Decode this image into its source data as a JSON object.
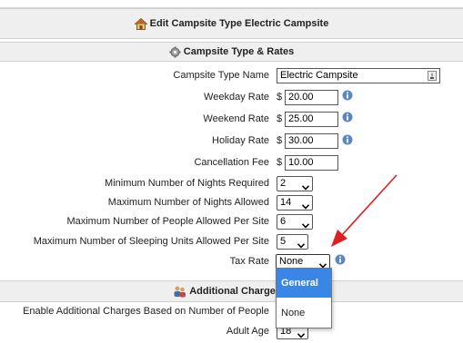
{
  "window": {
    "title": "Edit Campsite Type Electric Campsite"
  },
  "sections": {
    "type_rates": "Campsite Type & Rates",
    "additional_charges": "Additional Charges F"
  },
  "fields": {
    "type_name": {
      "label": "Campsite Type Name",
      "value": "Electric Campsite"
    },
    "weekday_rate": {
      "label": "Weekday Rate",
      "currency": "$",
      "value": "20.00"
    },
    "weekend_rate": {
      "label": "Weekend Rate",
      "currency": "$",
      "value": "25.00"
    },
    "holiday_rate": {
      "label": "Holiday Rate",
      "currency": "$",
      "value": "30.00"
    },
    "cancellation_fee": {
      "label": "Cancellation Fee",
      "currency": "$",
      "value": "10.00"
    },
    "min_nights": {
      "label": "Minimum Number of Nights Required",
      "value": "2"
    },
    "max_nights": {
      "label": "Maximum Number of Nights Allowed",
      "value": "14"
    },
    "max_people": {
      "label": "Maximum Number of People Allowed Per Site",
      "value": "6"
    },
    "max_sleeping_units": {
      "label": "Maximum Number of Sleeping Units Allowed Per Site",
      "value": "5"
    },
    "tax_rate": {
      "label": "Tax Rate",
      "value": "None",
      "options": [
        "General",
        "None"
      ],
      "highlighted": "General"
    },
    "additional_charges": {
      "label": "Enable Additional Charges Based on Number of People"
    },
    "adult_age": {
      "label": "Adult Age",
      "value": "18"
    }
  },
  "colors": {
    "annotation_arrow": "#e02020",
    "info_icon": "#5b86c5",
    "highlight": "#3a86e6"
  },
  "icons": {
    "title": "house-icon",
    "section1": "gear-icon",
    "section2": "people-icon",
    "info": "info-icon",
    "clear": "clear-icon",
    "dropdown": "chevron-down-icon"
  }
}
